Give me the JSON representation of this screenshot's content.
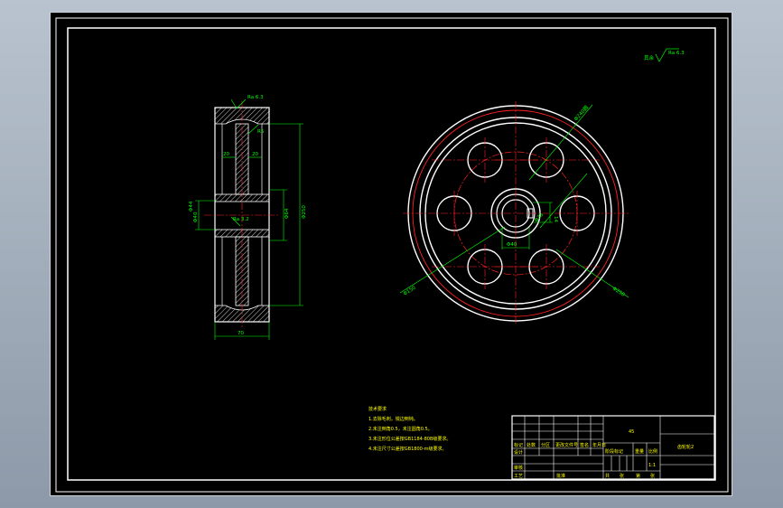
{
  "section_view": {
    "roughness_top": "Ra 6.3",
    "roughness_bore": "Ra 3.2",
    "dims": {
      "r5": "R5",
      "web_left": "20",
      "web_right": "20",
      "bore_dia": "Φ40",
      "hub_dia": "Φ64",
      "outer_dia": "Φ250",
      "width": "70",
      "keyway": "Φ44"
    }
  },
  "front_view": {
    "dims": {
      "rim_top": "Φ240圆",
      "bolt_circle": "Φ150",
      "hole_dia": "Φ38",
      "key_width": "14",
      "hub_bore": "Φ40",
      "outer_bottom": "Φ250"
    }
  },
  "surface_note": {
    "prefix": "其余",
    "value": "Ra 6.3"
  },
  "tech_notes": {
    "title": "技术要求",
    "lines": [
      "1.去除毛刺，锐边倒钝。",
      "2.未注倒角0.5，未注圆角0.5。",
      "3.未注形位公差按GB1184-80B级要求。",
      "4.未注尺寸公差按GB1800-m级要求。"
    ]
  },
  "title_block": {
    "material": "45",
    "part_name": "齿轮轮2",
    "left_cells": [
      "标记",
      "处数",
      "分区",
      "更改文件号",
      "签名",
      "年月日"
    ],
    "mid_cells": [
      "阶段标记",
      "重量",
      "比例"
    ],
    "ratio": "1:1",
    "bottom_cells": [
      "共",
      "张",
      "第",
      "张"
    ],
    "row_labels": [
      "设计",
      "审核",
      "工艺",
      "批准"
    ]
  },
  "colors": {
    "frame": "#ffffff",
    "dimension": "#00ff00",
    "centerline": "#ff2020",
    "notes": "#ffff00",
    "background": "#000000"
  }
}
